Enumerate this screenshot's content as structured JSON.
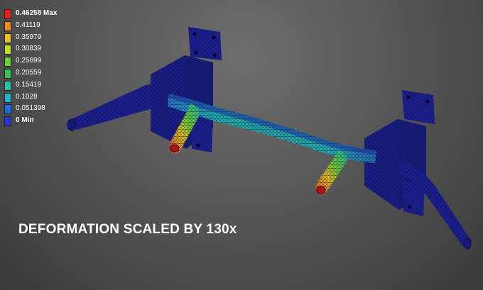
{
  "legend": {
    "entries": [
      {
        "label": "0.46258 Max",
        "color": "#e8201e"
      },
      {
        "label": "0.41119",
        "color": "#f08a1a"
      },
      {
        "label": "0.35979",
        "color": "#f2c21a"
      },
      {
        "label": "0.30839",
        "color": "#c6e01c"
      },
      {
        "label": "0.25699",
        "color": "#6ed32a"
      },
      {
        "label": "0.20559",
        "color": "#2ec45a"
      },
      {
        "label": "0.15419",
        "color": "#1fc9a6"
      },
      {
        "label": "0.1028",
        "color": "#1bb6d8"
      },
      {
        "label": "0.051398",
        "color": "#1a6fe8"
      },
      {
        "label": "0 Min",
        "color": "#2a2fd8"
      }
    ]
  },
  "caption": "DEFORMATION SCALED BY 130x",
  "colors": {
    "background": "#575757",
    "structure_min": "#1b2090",
    "mesh_line": "#0b0f40"
  }
}
